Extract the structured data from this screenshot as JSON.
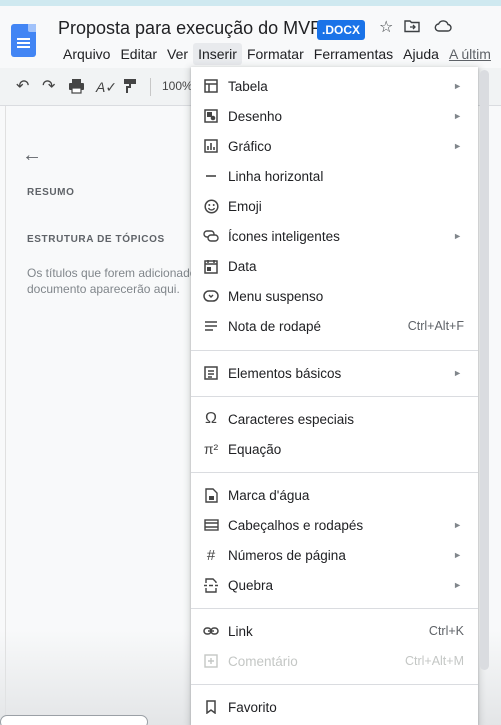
{
  "doc": {
    "title": "Proposta para execução do MVP",
    "badge": ".DOCX"
  },
  "menubar": [
    "Arquivo",
    "Editar",
    "Ver",
    "Inserir",
    "Formatar",
    "Ferramentas",
    "Ajuda",
    "A últim"
  ],
  "toolbar": {
    "zoom": "100%"
  },
  "sidebar": {
    "summary": "RESUMO",
    "outline": "ESTRUTURA DE TÓPICOS",
    "hint_line1": "Os títulos que forem adicionados ao",
    "hint_line2": "documento aparecerão aqui."
  },
  "insert_menu": [
    {
      "label": "Tabela",
      "icon": "table-icon",
      "submenu": true
    },
    {
      "label": "Desenho",
      "icon": "drawing-icon",
      "submenu": true
    },
    {
      "label": "Gráfico",
      "icon": "chart-icon",
      "submenu": true
    },
    {
      "label": "Linha horizontal",
      "icon": "horizontal-line-icon"
    },
    {
      "label": "Emoji",
      "icon": "emoji-icon"
    },
    {
      "label": "Ícones inteligentes",
      "icon": "smart-chips-icon",
      "submenu": true
    },
    {
      "label": "Data",
      "icon": "calendar-icon"
    },
    {
      "label": "Menu suspenso",
      "icon": "dropdown-icon"
    },
    {
      "label": "Nota de rodapé",
      "icon": "footnote-icon",
      "shortcut": "Ctrl+Alt+F"
    },
    {
      "label": "Elementos básicos",
      "icon": "building-blocks-icon",
      "submenu": true
    },
    {
      "label": "Caracteres especiais",
      "icon": "omega-icon"
    },
    {
      "label": "Equação",
      "icon": "pi-icon"
    },
    {
      "label": "Marca d'água",
      "icon": "watermark-icon"
    },
    {
      "label": "Cabeçalhos e rodapés",
      "icon": "header-footer-icon",
      "submenu": true
    },
    {
      "label": "Números de página",
      "icon": "hash-icon",
      "submenu": true
    },
    {
      "label": "Quebra",
      "icon": "break-icon",
      "submenu": true
    },
    {
      "label": "Link",
      "icon": "link-icon",
      "shortcut": "Ctrl+K"
    },
    {
      "label": "Comentário",
      "icon": "add-comment-icon",
      "shortcut": "Ctrl+Alt+M",
      "disabled": true
    },
    {
      "label": "Favorito",
      "icon": "bookmark-icon"
    }
  ]
}
